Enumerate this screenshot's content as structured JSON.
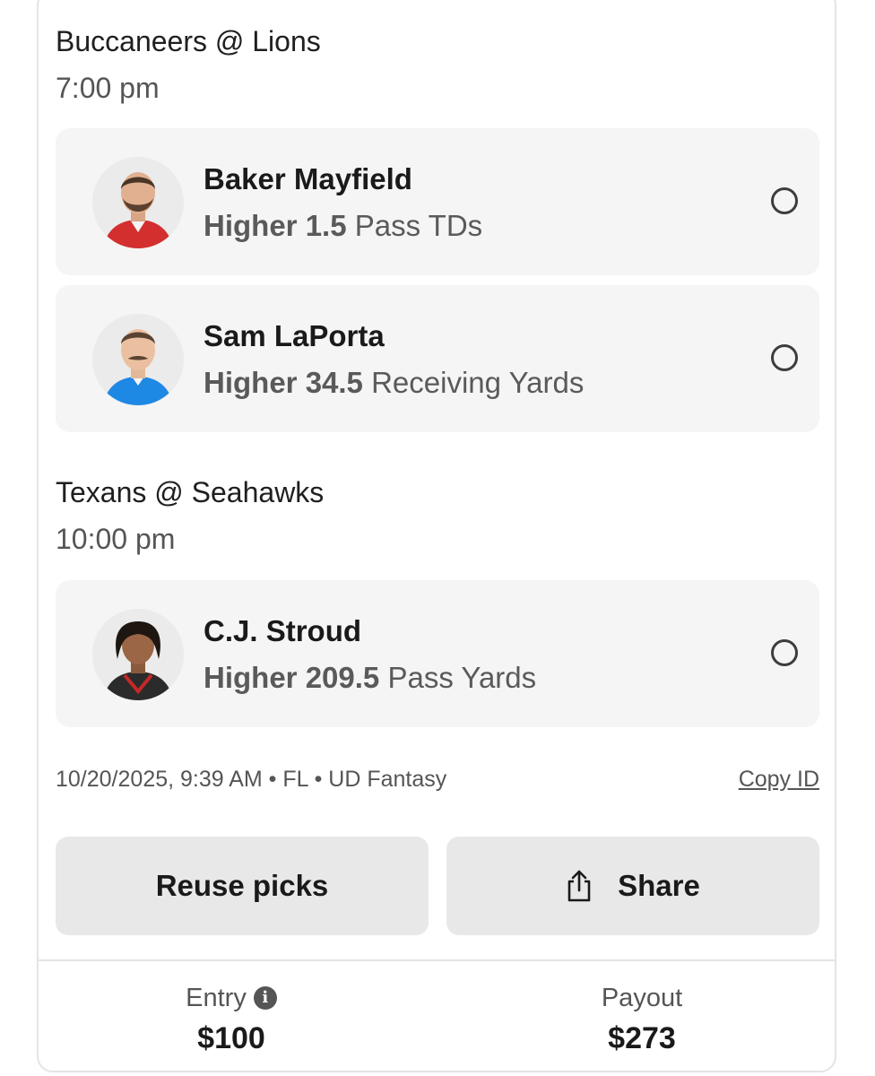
{
  "games": [
    {
      "title": "Buccaneers @ Lions",
      "time": "7:00 pm",
      "picks": [
        {
          "player": "Baker Mayfield",
          "direction": "Higher",
          "line": "1.5",
          "stat": "Pass TDs",
          "avatar_icon": "player-headshot-icon",
          "jersey_color": "#d32f2f"
        },
        {
          "player": "Sam LaPorta",
          "direction": "Higher",
          "line": "34.5",
          "stat": "Receiving Yards",
          "avatar_icon": "player-headshot-icon",
          "jersey_color": "#1e88e5"
        }
      ]
    },
    {
      "title": "Texans @ Seahawks",
      "time": "10:00 pm",
      "picks": [
        {
          "player": "C.J. Stroud",
          "direction": "Higher",
          "line": "209.5",
          "stat": "Pass Yards",
          "avatar_icon": "player-headshot-icon",
          "jersey_color": "#c62828"
        }
      ]
    }
  ],
  "meta": {
    "info": "10/20/2025, 9:39 AM • FL • UD Fantasy",
    "copy_id_label": "Copy ID"
  },
  "buttons": {
    "reuse_label": "Reuse picks",
    "share_label": "Share"
  },
  "footer": {
    "entry_label": "Entry",
    "entry_value": "$100",
    "payout_label": "Payout",
    "payout_value": "$273"
  },
  "colors": {
    "card_bg": "#f5f5f5",
    "button_bg": "#e8e8e8",
    "text_primary": "#1a1a1a",
    "text_secondary": "#555555"
  }
}
